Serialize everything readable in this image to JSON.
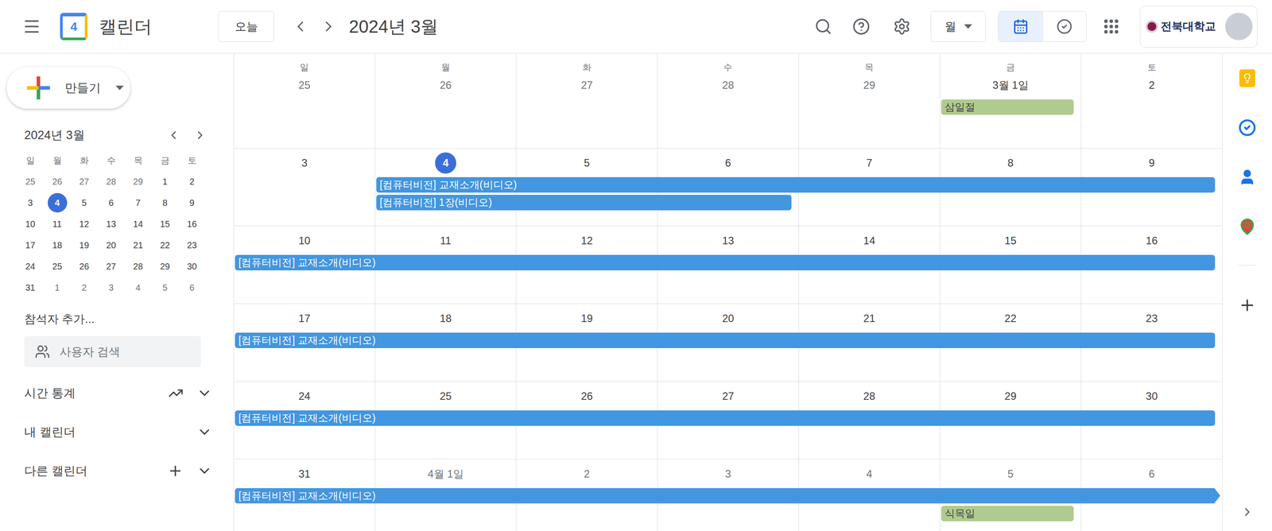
{
  "header": {
    "app_name": "캘린더",
    "logo_date": "4",
    "today_button": "오늘",
    "title": "2024년 3월",
    "view_select": "월",
    "view_toggle": [
      {
        "kind": "calendar",
        "selected": true
      },
      {
        "kind": "tasks",
        "selected": false
      }
    ],
    "account": "전북대학교"
  },
  "sidebar": {
    "create_button": "만들기",
    "mini_calendar": {
      "title": "2024년 3월",
      "weekdays": [
        "일",
        "월",
        "화",
        "수",
        "목",
        "금",
        "토"
      ],
      "weeks": [
        [
          {
            "label": "25",
            "muted": true,
            "selected": false
          },
          {
            "label": "26",
            "muted": true,
            "selected": false
          },
          {
            "label": "27",
            "muted": true,
            "selected": false
          },
          {
            "label": "28",
            "muted": true,
            "selected": false
          },
          {
            "label": "29",
            "muted": true,
            "selected": false
          },
          {
            "label": "1",
            "muted": false,
            "selected": false
          },
          {
            "label": "2",
            "muted": false,
            "selected": false
          }
        ],
        [
          {
            "label": "3",
            "muted": false,
            "selected": false
          },
          {
            "label": "4",
            "muted": false,
            "selected": true
          },
          {
            "label": "5",
            "muted": false,
            "selected": false
          },
          {
            "label": "6",
            "muted": false,
            "selected": false
          },
          {
            "label": "7",
            "muted": false,
            "selected": false
          },
          {
            "label": "8",
            "muted": false,
            "selected": false
          },
          {
            "label": "9",
            "muted": false,
            "selected": false
          }
        ],
        [
          {
            "label": "10",
            "muted": false,
            "selected": false
          },
          {
            "label": "11",
            "muted": false,
            "selected": false
          },
          {
            "label": "12",
            "muted": false,
            "selected": false
          },
          {
            "label": "13",
            "muted": false,
            "selected": false
          },
          {
            "label": "14",
            "muted": false,
            "selected": false
          },
          {
            "label": "15",
            "muted": false,
            "selected": false
          },
          {
            "label": "16",
            "muted": false,
            "selected": false
          }
        ],
        [
          {
            "label": "17",
            "muted": false,
            "selected": false
          },
          {
            "label": "18",
            "muted": false,
            "selected": false
          },
          {
            "label": "19",
            "muted": false,
            "selected": false
          },
          {
            "label": "20",
            "muted": false,
            "selected": false
          },
          {
            "label": "21",
            "muted": false,
            "selected": false
          },
          {
            "label": "22",
            "muted": false,
            "selected": false
          },
          {
            "label": "23",
            "muted": false,
            "selected": false
          }
        ],
        [
          {
            "label": "24",
            "muted": false,
            "selected": false
          },
          {
            "label": "25",
            "muted": false,
            "selected": false
          },
          {
            "label": "26",
            "muted": false,
            "selected": false
          },
          {
            "label": "27",
            "muted": false,
            "selected": false
          },
          {
            "label": "28",
            "muted": false,
            "selected": false
          },
          {
            "label": "29",
            "muted": false,
            "selected": false
          },
          {
            "label": "30",
            "muted": false,
            "selected": false
          }
        ],
        [
          {
            "label": "31",
            "muted": false,
            "selected": false
          },
          {
            "label": "1",
            "muted": true,
            "selected": false
          },
          {
            "label": "2",
            "muted": true,
            "selected": false
          },
          {
            "label": "3",
            "muted": true,
            "selected": false
          },
          {
            "label": "4",
            "muted": true,
            "selected": false
          },
          {
            "label": "5",
            "muted": true,
            "selected": false
          },
          {
            "label": "6",
            "muted": true,
            "selected": false
          }
        ]
      ]
    },
    "add_participants": "참석자 추가...",
    "search": {
      "placeholder": "사용자 검색"
    },
    "sections": [
      {
        "label": "시간 통계",
        "kind": "stats"
      },
      {
        "label": "내 캘린더",
        "kind": "plain"
      },
      {
        "label": "다른 캘린더",
        "kind": "add"
      }
    ]
  },
  "month": {
    "weekdays": [
      "일",
      "월",
      "화",
      "수",
      "목",
      "금",
      "토"
    ],
    "weeks": [
      {
        "days": [
          {
            "label": "25",
            "muted": true,
            "selected": false
          },
          {
            "label": "26",
            "muted": true,
            "selected": false
          },
          {
            "label": "27",
            "muted": true,
            "selected": false
          },
          {
            "label": "28",
            "muted": true,
            "selected": false
          },
          {
            "label": "29",
            "muted": true,
            "selected": false
          },
          {
            "label": "3월 1일",
            "muted": false,
            "selected": false
          },
          {
            "label": "2",
            "muted": false,
            "selected": false
          }
        ],
        "events": [
          {
            "label": "삼일절",
            "kind": "holiday",
            "start": 5,
            "span": 1,
            "continues": false,
            "color": "#b0cb8f"
          }
        ]
      },
      {
        "days": [
          {
            "label": "3",
            "muted": false,
            "selected": false
          },
          {
            "label": "4",
            "muted": false,
            "selected": true
          },
          {
            "label": "5",
            "muted": false,
            "selected": false
          },
          {
            "label": "6",
            "muted": false,
            "selected": false
          },
          {
            "label": "7",
            "muted": false,
            "selected": false
          },
          {
            "label": "8",
            "muted": false,
            "selected": false
          },
          {
            "label": "9",
            "muted": false,
            "selected": false
          }
        ],
        "events": [
          {
            "label": "[컴퓨터비전] 교재소개(비디오)",
            "kind": "event",
            "start": 1,
            "span": 6,
            "continues": false,
            "color": "#4396e0"
          },
          {
            "label": "[컴퓨터비전] 1장(비디오)",
            "kind": "event",
            "start": 1,
            "span": 3,
            "continues": false,
            "color": "#4396e0"
          }
        ]
      },
      {
        "days": [
          {
            "label": "10",
            "muted": false,
            "selected": false
          },
          {
            "label": "11",
            "muted": false,
            "selected": false
          },
          {
            "label": "12",
            "muted": false,
            "selected": false
          },
          {
            "label": "13",
            "muted": false,
            "selected": false
          },
          {
            "label": "14",
            "muted": false,
            "selected": false
          },
          {
            "label": "15",
            "muted": false,
            "selected": false
          },
          {
            "label": "16",
            "muted": false,
            "selected": false
          }
        ],
        "events": [
          {
            "label": "[컴퓨터비전] 교재소개(비디오)",
            "kind": "event",
            "start": 0,
            "span": 7,
            "continues": false,
            "color": "#4396e0"
          }
        ]
      },
      {
        "days": [
          {
            "label": "17",
            "muted": false,
            "selected": false
          },
          {
            "label": "18",
            "muted": false,
            "selected": false
          },
          {
            "label": "19",
            "muted": false,
            "selected": false
          },
          {
            "label": "20",
            "muted": false,
            "selected": false
          },
          {
            "label": "21",
            "muted": false,
            "selected": false
          },
          {
            "label": "22",
            "muted": false,
            "selected": false
          },
          {
            "label": "23",
            "muted": false,
            "selected": false
          }
        ],
        "events": [
          {
            "label": "[컴퓨터비전] 교재소개(비디오)",
            "kind": "event",
            "start": 0,
            "span": 7,
            "continues": false,
            "color": "#4396e0"
          }
        ]
      },
      {
        "days": [
          {
            "label": "24",
            "muted": false,
            "selected": false
          },
          {
            "label": "25",
            "muted": false,
            "selected": false
          },
          {
            "label": "26",
            "muted": false,
            "selected": false
          },
          {
            "label": "27",
            "muted": false,
            "selected": false
          },
          {
            "label": "28",
            "muted": false,
            "selected": false
          },
          {
            "label": "29",
            "muted": false,
            "selected": false
          },
          {
            "label": "30",
            "muted": false,
            "selected": false
          }
        ],
        "events": [
          {
            "label": "[컴퓨터비전] 교재소개(비디오)",
            "kind": "event",
            "start": 0,
            "span": 7,
            "continues": false,
            "color": "#4396e0"
          }
        ]
      },
      {
        "days": [
          {
            "label": "31",
            "muted": false,
            "selected": false
          },
          {
            "label": "4월 1일",
            "muted": true,
            "selected": false
          },
          {
            "label": "2",
            "muted": true,
            "selected": false
          },
          {
            "label": "3",
            "muted": true,
            "selected": false
          },
          {
            "label": "4",
            "muted": true,
            "selected": false
          },
          {
            "label": "5",
            "muted": true,
            "selected": false
          },
          {
            "label": "6",
            "muted": true,
            "selected": false
          }
        ],
        "events": [
          {
            "label": "[컴퓨터비전] 교재소개(비디오)",
            "kind": "event",
            "start": 0,
            "span": 7,
            "continues": true,
            "color": "#4396e0"
          },
          {
            "label": "식목일",
            "kind": "holiday",
            "start": 5,
            "span": 1,
            "continues": false,
            "color": "#b0cb8f"
          }
        ]
      }
    ]
  }
}
